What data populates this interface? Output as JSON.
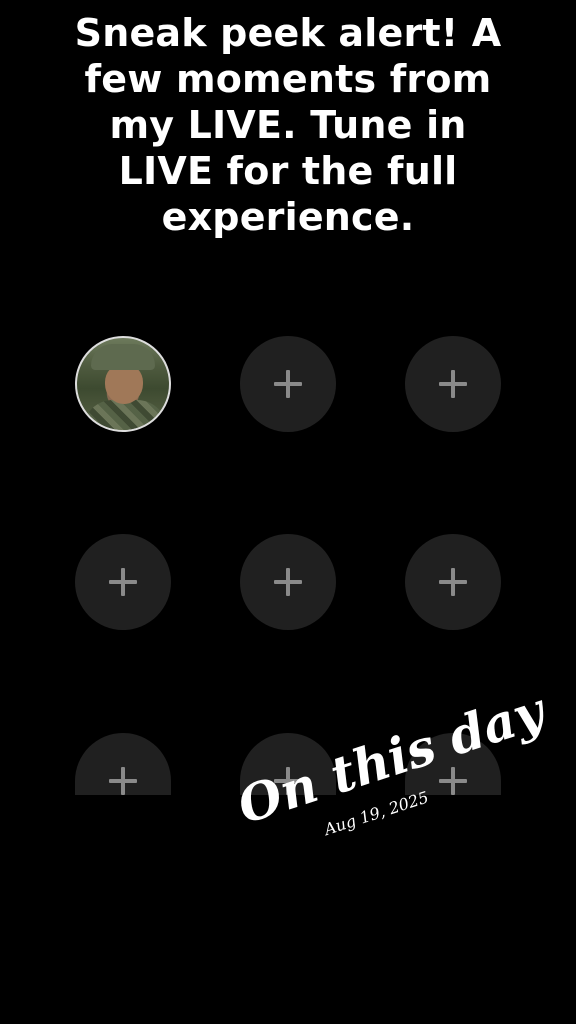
{
  "caption": {
    "line1": "Sneak peek alert! A",
    "line2": "few moments from",
    "line3": "my LIVE. Tune in",
    "line4": "LIVE for the full",
    "line5": "experience."
  },
  "grid": {
    "slots": [
      {
        "kind": "avatar",
        "icon": "profile-photo"
      },
      {
        "kind": "add",
        "icon": "plus-icon"
      },
      {
        "kind": "add",
        "icon": "plus-icon"
      },
      {
        "kind": "add",
        "icon": "plus-icon"
      },
      {
        "kind": "add",
        "icon": "plus-icon"
      },
      {
        "kind": "add",
        "icon": "plus-icon"
      },
      {
        "kind": "add",
        "icon": "plus-icon"
      },
      {
        "kind": "add",
        "icon": "plus-icon"
      },
      {
        "kind": "add",
        "icon": "plus-icon"
      }
    ]
  },
  "memory_stamp": {
    "title": "On this day",
    "date": "Aug 19, 2025"
  },
  "colors": {
    "background": "#000000",
    "slot": "#202020",
    "plus": "#8a8a8a",
    "text": "#ffffff"
  }
}
